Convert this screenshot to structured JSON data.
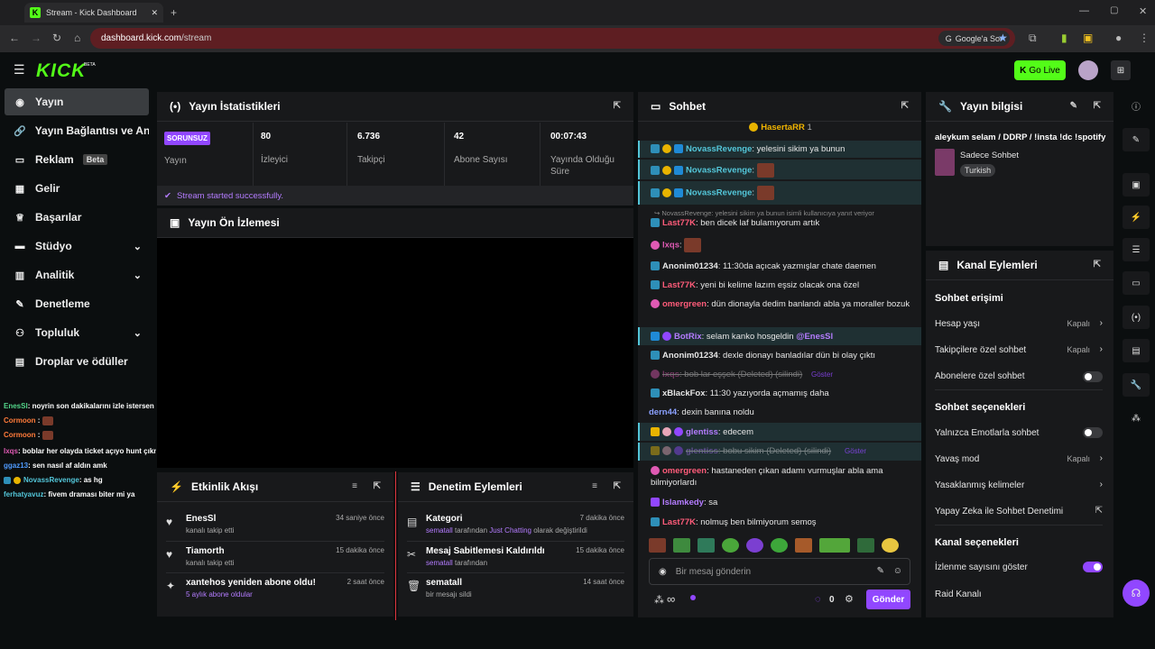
{
  "browser": {
    "tab_title": "Stream - Kick Dashboard",
    "url_host": "dashboard.kick.com",
    "url_path": "/stream",
    "google_btn": "Google'a Sor"
  },
  "header": {
    "logo": "KICK",
    "beta": "BETA",
    "go_live": "Go Live"
  },
  "sidebar": {
    "items": [
      {
        "label": "Yayın",
        "icon": "stream-icon"
      },
      {
        "label": "Yayın Bağlantısı ve Anahtarı",
        "icon": "link-icon"
      },
      {
        "label": "Reklam",
        "badge": "Beta",
        "icon": "ad-icon"
      },
      {
        "label": "Gelir",
        "icon": "revenue-icon"
      },
      {
        "label": "Başarılar",
        "icon": "trophy-icon"
      },
      {
        "label": "Stüdyo",
        "icon": "studio-icon"
      },
      {
        "label": "Analitik",
        "icon": "chart-icon"
      },
      {
        "label": "Denetleme",
        "icon": "wrench-icon"
      },
      {
        "label": "Topluluk",
        "icon": "community-icon"
      },
      {
        "label": "Droplar ve ödüller",
        "icon": "gift-icon"
      }
    ]
  },
  "overlay_chat": [
    {
      "user": "EnesSl",
      "text": ": noyrin son dakikalarını izle istersen",
      "color": "#53d68a"
    },
    {
      "user": "Cormoon",
      "text": " :",
      "color": "#ff7b3a",
      "emote": true
    },
    {
      "user": "Cormoon",
      "text": " :",
      "color": "#ff7b3a",
      "emote": true
    },
    {
      "user": "lxqs",
      "text": ": boblar her olayda ticket açıyo hunt çıkmıyo taco bekçileri",
      "color": "#e05ab4"
    },
    {
      "user": "ggaz13",
      "text": ": sen nasıl af aldın amk",
      "color": "#4f9bff"
    },
    {
      "user": "NovassRevenge",
      "text": ": as hg",
      "color": "#53c6d9"
    },
    {
      "user": "ferhatyavuz",
      "text": ": fivem draması biter mi ya",
      "color": "#53c6d9"
    }
  ],
  "stats": {
    "title": "Yayın İstatistikleri",
    "status_badge": "SORUNSUZ",
    "status_label": "Yayın",
    "viewers": "80",
    "viewers_label": "İzleyici",
    "followers": "6.736",
    "followers_label": "Takipçi",
    "subs": "42",
    "subs_label": "Abone Sayısı",
    "uptime": "00:07:43",
    "uptime_label": "Yayında Olduğu Süre",
    "success_msg": "Stream started successfully."
  },
  "preview": {
    "title": "Yayın Ön İzlemesi"
  },
  "activity": {
    "title": "Etkinlik Akışı",
    "rows": [
      {
        "name": "EnesSl",
        "sub": "kanalı takip etti",
        "time": "34 saniye önce"
      },
      {
        "name": "Tiamorth",
        "sub": "kanalı takip etti",
        "time": "15 dakika önce"
      },
      {
        "name": "xantehos yeniden abone oldu!",
        "sub": "5 aylık abone oldular",
        "time": "2 saat önce"
      }
    ]
  },
  "moderation": {
    "title": "Denetim Eylemleri",
    "rows": [
      {
        "name": "Kategori",
        "sub_user": "sematall",
        "sub_mid": " tarafından ",
        "sub_link": "Just Chatting",
        "sub_end": " olarak değiştirildi",
        "time": "7 dakika önce"
      },
      {
        "name": "Mesaj Sabitlemesi Kaldırıldı",
        "sub_user": "sematall",
        "sub_mid": " tarafından",
        "sub_link": "",
        "sub_end": "",
        "time": "15 dakika önce"
      },
      {
        "name": "sematall",
        "sub_user": "",
        "sub_mid": "bir mesajı sildi",
        "sub_link": "",
        "sub_end": "",
        "time": "14 saat önce"
      }
    ]
  },
  "chat": {
    "title": "Sohbet",
    "pinned_user": "HasertaRR",
    "pinned_count": "1",
    "reply_note": "↪ NovassRevenge: yelesini sikim ya bunun isimli kullanıcıya yanıt veriyor",
    "messages": [
      {
        "user": "NovassRevenge",
        "text": ": yelesini sikim ya bunun",
        "color": "#53c6d9"
      },
      {
        "user": "NovassRevenge",
        "text": ":",
        "color": "#53c6d9"
      },
      {
        "user": "NovassRevenge",
        "text": ":",
        "color": "#53c6d9"
      },
      {
        "user": "Last77K",
        "text": ": ben dicek laf bulamıyorum artık",
        "color": "#ff5c7a"
      },
      {
        "user": "lxqs",
        "text": ":",
        "color": "#e05ab4"
      },
      {
        "user": "Anonim01234",
        "text": ": 11:30da açıcak yazmışlar chate daemen",
        "color": "#e6e6e6"
      },
      {
        "user": "Last77K",
        "text": ": yeni bi kelime lazım eşsiz olacak ona özel",
        "color": "#ff5c7a"
      },
      {
        "user": "omergreen",
        "text": ": dün dionayla dedim banlandı abla ya moraller bozuk",
        "color": "#ff5c7a"
      },
      {
        "user": "BotRix",
        "text": ": selam kanko hosgeldin ",
        "mention": "@EnesSl",
        "color": "#b47cff"
      },
      {
        "user": "Anonim01234",
        "text": ": dexle dionayı banladılar dün bi olay çıktı",
        "color": "#e6e6e6"
      },
      {
        "user": "lxqs",
        "text": ": bob lar eşşek (Deleted) (silindi)",
        "extra": "Göster",
        "color": "#e05ab4"
      },
      {
        "user": "xBlackFox",
        "text": ": 11:30 yazıyorda açmamış daha",
        "color": "#e6e6e6"
      },
      {
        "user": "dern44",
        "text": ": dexin banına noldu",
        "color": "#8aa0ff"
      },
      {
        "user": "glentiss",
        "text": ": edecem",
        "color": "#b47cff"
      },
      {
        "user": "glentiss",
        "text": ": bobu sikim (Deleted) (silindi)",
        "extra": "Göster",
        "color": "#b47cff"
      },
      {
        "user": "omergreen",
        "text": ": hastaneden çıkan adamı vurmuşlar abla ama bilmiyorlardı",
        "color": "#ff5c7a"
      },
      {
        "user": "Islamkedy",
        "text": ": sa",
        "color": "#b47cff"
      },
      {
        "user": "Last77K",
        "text": ": nolmuş ben bilmiyorum semoş",
        "color": "#ff5c7a"
      }
    ],
    "input_placeholder": "Bir mesaj gönderin",
    "points": "0",
    "send": "Gönder"
  },
  "stream_info": {
    "title": "Yayın bilgisi",
    "stream_title": "aleykum selam / DDRP / !insta !dc !spotify",
    "category": "Sadece Sohbet",
    "language": "Turkish"
  },
  "channel_actions": {
    "title": "Kanal Eylemleri",
    "chat_access": "Sohbet erişimi",
    "account_age": "Hesap yaşı",
    "account_age_v": "Kapalı",
    "followers_only": "Takipçilere özel sohbet",
    "followers_only_v": "Kapalı",
    "subs_only": "Abonelere özel sohbet",
    "chat_options": "Sohbet seçenekleri",
    "emotes_only": "Yalnızca Emotlarla sohbet",
    "slow_mode": "Yavaş mod",
    "slow_mode_v": "Kapalı",
    "banned_words": "Yasaklanmış kelimeler",
    "ai_mod": "Yapay Zeka ile Sohbet Denetimi",
    "channel_options": "Kanal seçenekleri",
    "show_viewers": "İzlenme sayısını göster",
    "raid": "Raid Kanalı"
  },
  "colors": {
    "accent": "#53fc18",
    "purple": "#9147ff",
    "panel": "#18191b"
  }
}
